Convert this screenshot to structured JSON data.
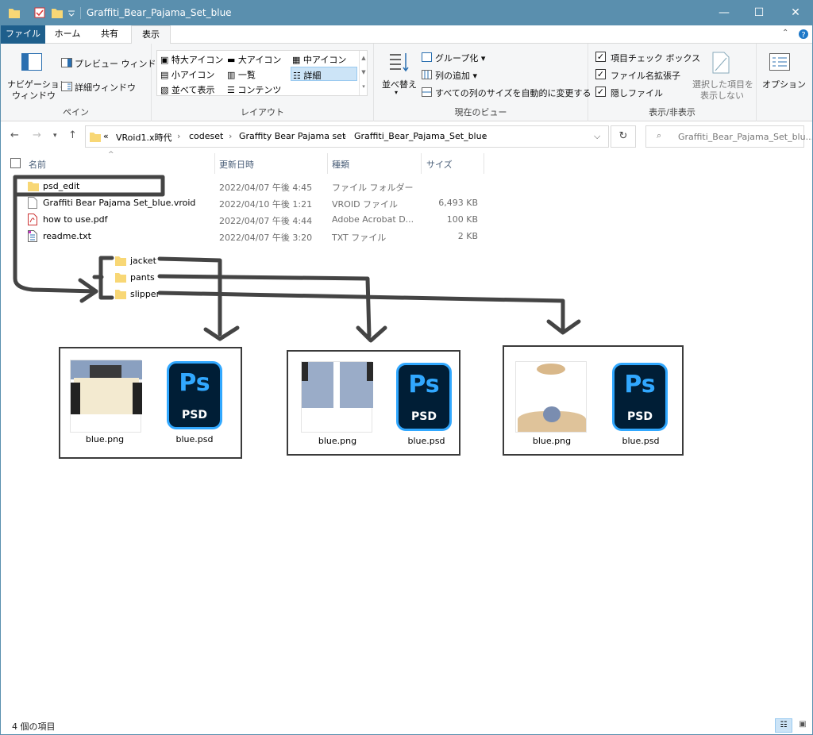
{
  "window": {
    "title": "Graffiti_Bear_Pajama_Set_blue",
    "minimize": "—",
    "maximize": "☐",
    "close": "✕"
  },
  "tabs": [
    "ファイル",
    "ホーム",
    "共有",
    "表示"
  ],
  "ribbon": {
    "pane": {
      "nav_pane_1": "ナビゲーション",
      "nav_pane_2": "ウィンドウ",
      "preview": "プレビュー ウィンドウ",
      "details": "詳細ウィンドウ",
      "label": "ペイン"
    },
    "layout": {
      "items": [
        "特大アイコン",
        "大アイコン",
        "中アイコン",
        "小アイコン",
        "一覧",
        "詳細",
        "並べて表示",
        "コンテンツ"
      ],
      "selected": "詳細",
      "label": "レイアウト"
    },
    "current_view": {
      "sort_by": "並べ替え",
      "group_by": "グループ化",
      "add_columns": "列の追加",
      "size_all_columns": "すべての列のサイズを自動的に変更する",
      "label": "現在のビュー"
    },
    "show_hide": {
      "item_checkboxes": "項目チェック ボックス",
      "file_extensions": "ファイル名拡張子",
      "hidden_items": "隠しファイル",
      "hide_selected_1": "選択した項目を",
      "hide_selected_2": "表示しない",
      "label": "表示/非表示"
    },
    "options": "オプション"
  },
  "address": {
    "overflow": "«",
    "crumbs": [
      "VRoid1.x時代",
      "codeset",
      "Graffity Bear Pajama set",
      "Graffiti_Bear_Pajama_Set_blue"
    ],
    "search_placeholder": "Graffiti_Bear_Pajama_Set_blu..."
  },
  "columns": [
    "名前",
    "更新日時",
    "種類",
    "サイズ"
  ],
  "files": [
    {
      "name": "psd_edit",
      "date": "2022/04/07 午後 4:45",
      "type": "ファイル フォルダー",
      "size": "",
      "icon": "folder-icon"
    },
    {
      "name": "Graffiti Bear Pajama Set_blue.vroid",
      "date": "2022/04/10 午後 1:21",
      "type": "VROID ファイル",
      "size": "6,493 KB",
      "icon": "file-icon"
    },
    {
      "name": "how to use.pdf",
      "date": "2022/04/07 午後 4:44",
      "type": "Adobe Acrobat D...",
      "size": "100 KB",
      "icon": "pdf-icon"
    },
    {
      "name": "readme.txt",
      "date": "2022/04/07 午後 3:20",
      "type": "TXT ファイル",
      "size": "2 KB",
      "icon": "text-file-icon"
    }
  ],
  "annotation": {
    "subfolders": [
      "jacket",
      "pants",
      "slipper"
    ],
    "box_files": {
      "png": "blue.png",
      "psd": "blue.psd",
      "psd_badge_top": "Ps",
      "psd_badge_bottom": "PSD"
    }
  },
  "status": {
    "count": "4 個の項目"
  },
  "colors": {
    "titlebar": "#5a8fae",
    "file_tab": "#1e5f8c",
    "selection": "#cce4f7",
    "folder": "#f8d775",
    "ink": "#444444",
    "ps_blue": "#31a8ff",
    "ps_dark": "#001e36"
  }
}
